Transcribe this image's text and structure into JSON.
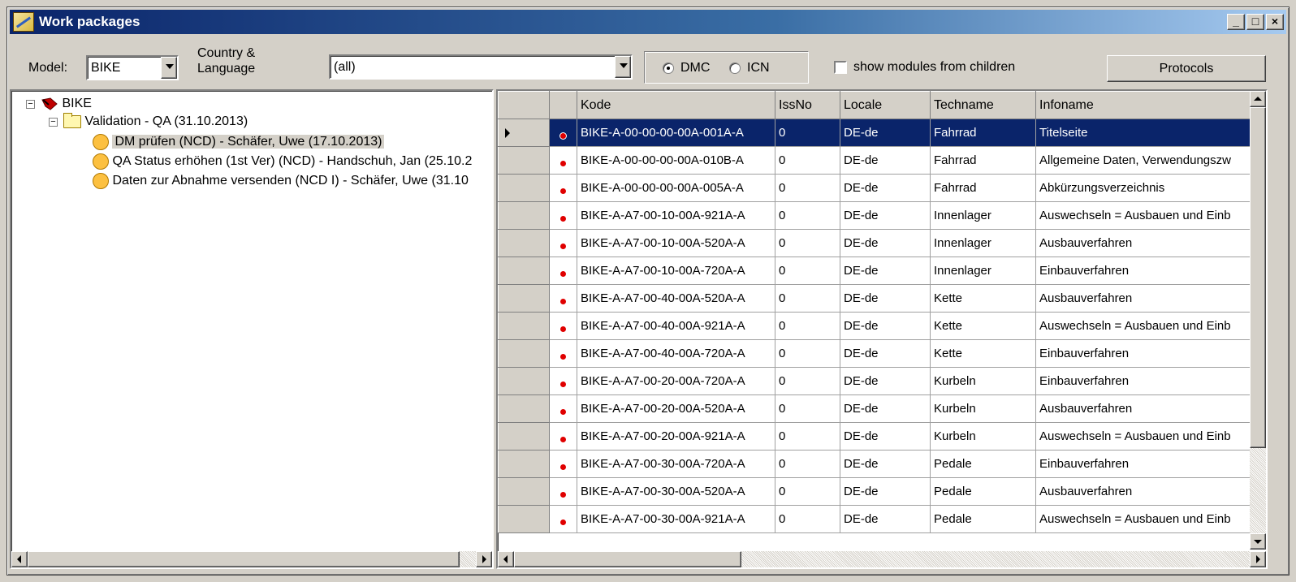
{
  "window": {
    "title": "Work packages",
    "buttons": {
      "minimize": "_",
      "maximize": "□",
      "close": "×"
    }
  },
  "toolbar": {
    "model_label": "Model:",
    "model_value": "BIKE",
    "country_label_1": "Country  &",
    "country_label_2": "Language",
    "country_value": "(all)",
    "radio_dmc": "DMC",
    "radio_icn": "ICN",
    "radio_selected": "DMC",
    "show_children_label": "show modules from children",
    "protocols_button": "Protocols"
  },
  "tree": {
    "root": "BIKE",
    "folder": "Validation - QA (31.10.2013)",
    "items": [
      "DM prüfen (NCD) - Schäfer, Uwe (17.10.2013)",
      "QA Status erhöhen (1st Ver) (NCD) - Handschuh, Jan (25.10.2",
      "Daten zur Abnahme versenden (NCD I) - Schäfer, Uwe (31.10"
    ],
    "selected_index": 0
  },
  "grid": {
    "columns": [
      "Kode",
      "IssNo",
      "Locale",
      "Techname",
      "Infoname"
    ],
    "selected_row": 0,
    "rows": [
      [
        "BIKE-A-00-00-00-00A-001A-A",
        "0",
        "DE-de",
        "Fahrrad",
        "Titelseite"
      ],
      [
        "BIKE-A-00-00-00-00A-010B-A",
        "0",
        "DE-de",
        "Fahrrad",
        "Allgemeine Daten, Verwendungszw"
      ],
      [
        "BIKE-A-00-00-00-00A-005A-A",
        "0",
        "DE-de",
        "Fahrrad",
        "Abkürzungsverzeichnis"
      ],
      [
        "BIKE-A-A7-00-10-00A-921A-A",
        "0",
        "DE-de",
        "Innenlager",
        "Auswechseln = Ausbauen und Einb"
      ],
      [
        "BIKE-A-A7-00-10-00A-520A-A",
        "0",
        "DE-de",
        "Innenlager",
        "Ausbauverfahren"
      ],
      [
        "BIKE-A-A7-00-10-00A-720A-A",
        "0",
        "DE-de",
        "Innenlager",
        "Einbauverfahren"
      ],
      [
        "BIKE-A-A7-00-40-00A-520A-A",
        "0",
        "DE-de",
        "Kette",
        "Ausbauverfahren"
      ],
      [
        "BIKE-A-A7-00-40-00A-921A-A",
        "0",
        "DE-de",
        "Kette",
        "Auswechseln = Ausbauen und Einb"
      ],
      [
        "BIKE-A-A7-00-40-00A-720A-A",
        "0",
        "DE-de",
        "Kette",
        "Einbauverfahren"
      ],
      [
        "BIKE-A-A7-00-20-00A-720A-A",
        "0",
        "DE-de",
        "Kurbeln",
        "Einbauverfahren"
      ],
      [
        "BIKE-A-A7-00-20-00A-520A-A",
        "0",
        "DE-de",
        "Kurbeln",
        "Ausbauverfahren"
      ],
      [
        "BIKE-A-A7-00-20-00A-921A-A",
        "0",
        "DE-de",
        "Kurbeln",
        "Auswechseln = Ausbauen und Einb"
      ],
      [
        "BIKE-A-A7-00-30-00A-720A-A",
        "0",
        "DE-de",
        "Pedale",
        "Einbauverfahren"
      ],
      [
        "BIKE-A-A7-00-30-00A-520A-A",
        "0",
        "DE-de",
        "Pedale",
        "Ausbauverfahren"
      ],
      [
        "BIKE-A-A7-00-30-00A-921A-A",
        "0",
        "DE-de",
        "Pedale",
        "Auswechseln = Ausbauen und Einb"
      ]
    ]
  },
  "colors": {
    "title_start": "#0a246a",
    "selection": "#0a246a",
    "status_dot": "#e00000",
    "tree_node": "#fcc040"
  },
  "icons": {
    "window": "work-packages-icon",
    "model": "bike-model-icon",
    "folder": "folder-icon",
    "task": "task-octagon-icon",
    "status": "red-dot-icon"
  }
}
